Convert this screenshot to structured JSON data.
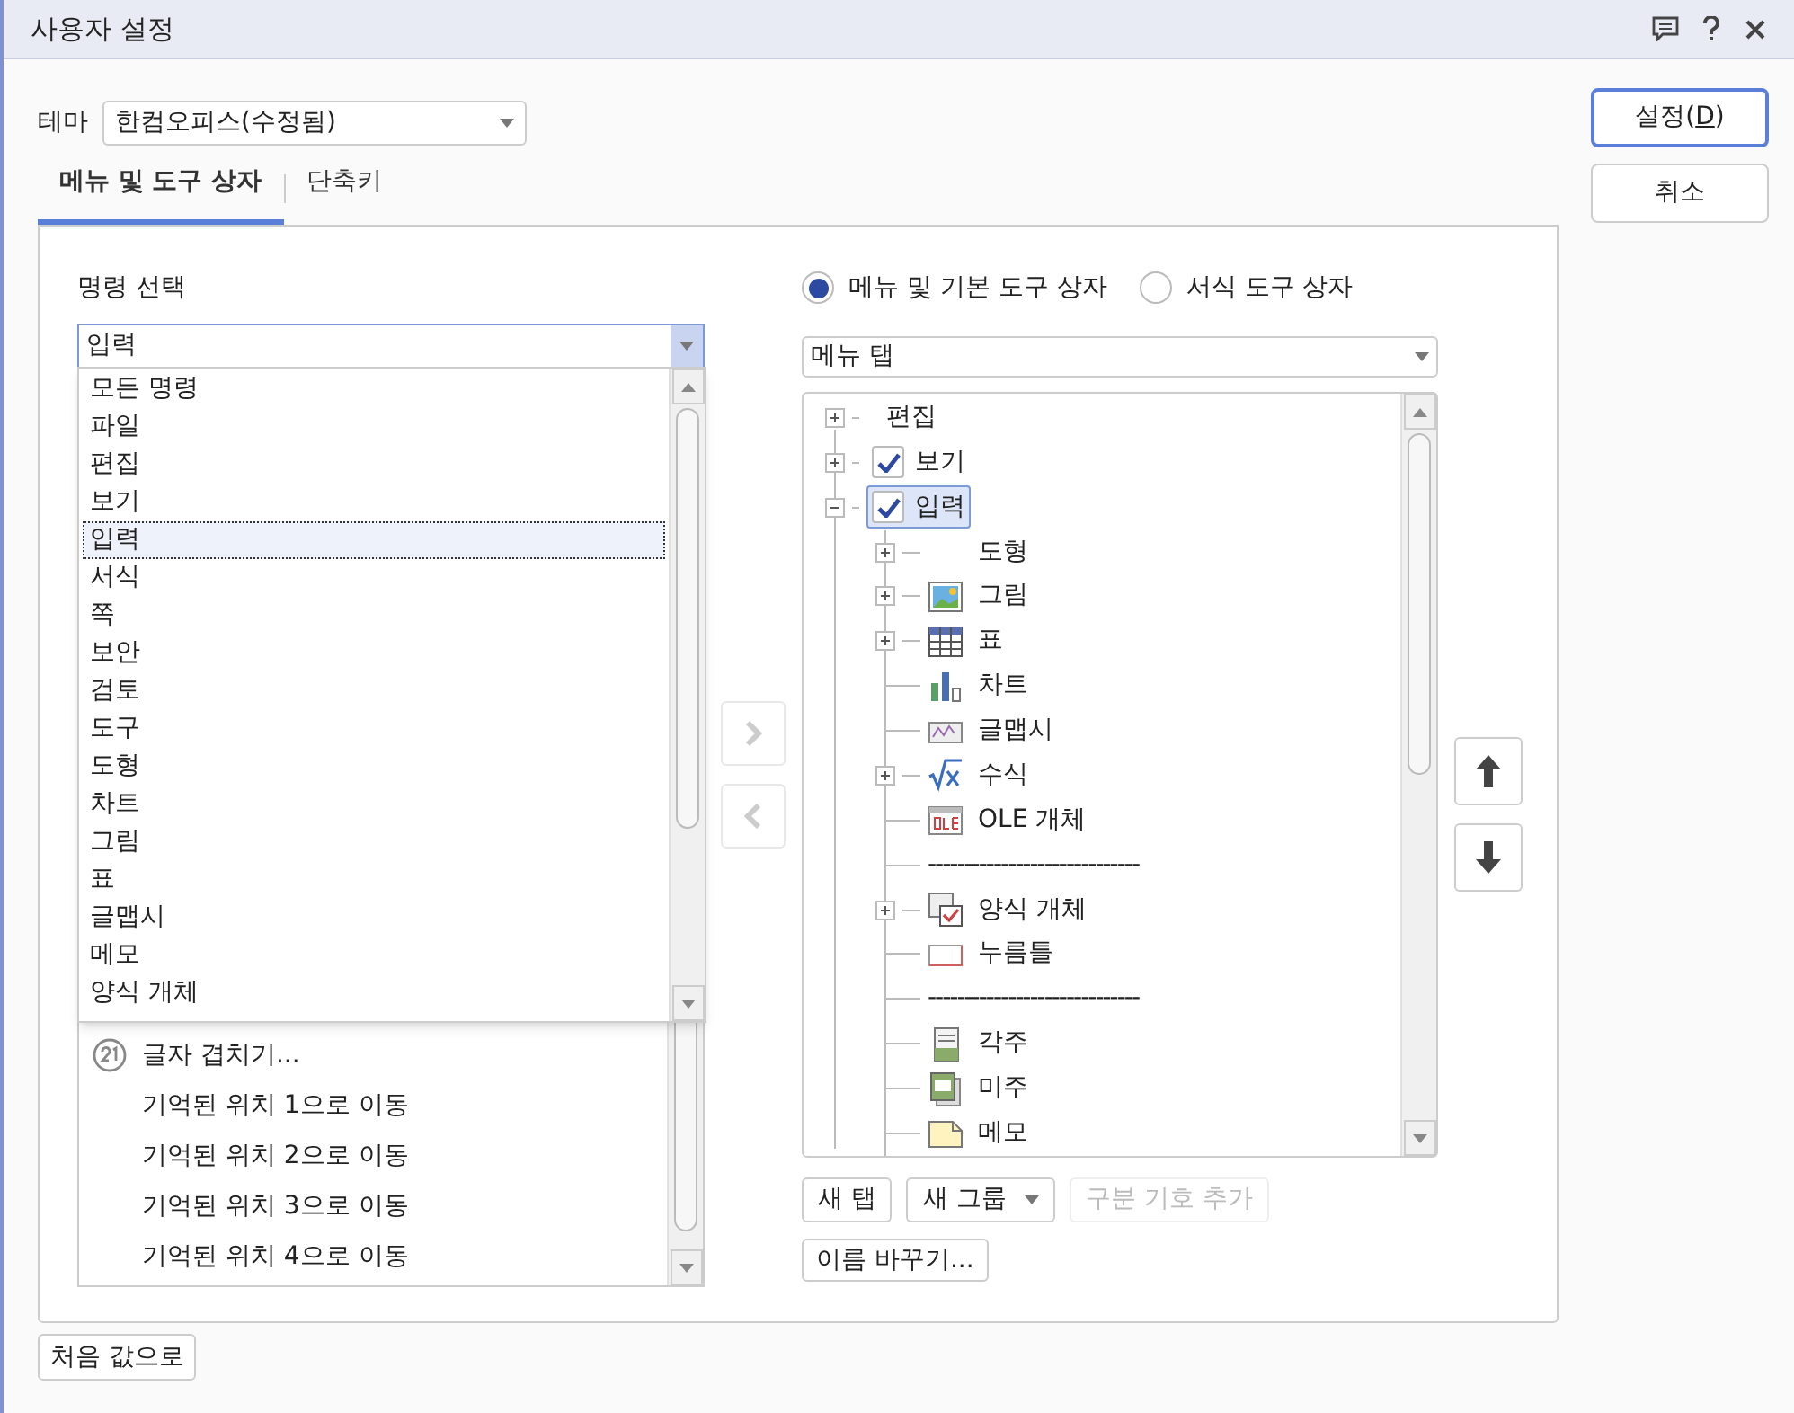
{
  "window": {
    "title": "사용자 설정"
  },
  "theme": {
    "label": "테마",
    "value": "한컴오피스(수정됨)"
  },
  "tabs": [
    {
      "label": "메뉴 및 도구 상자",
      "selected": true
    },
    {
      "label": "단축키",
      "selected": false
    }
  ],
  "command_select": {
    "label": "명령 선택",
    "value": "입력",
    "dropdown_items": [
      {
        "label": "모든 명령",
        "selected": false
      },
      {
        "label": "파일",
        "selected": false
      },
      {
        "label": "편집",
        "selected": false
      },
      {
        "label": "보기",
        "selected": false
      },
      {
        "label": "입력",
        "selected": true
      },
      {
        "label": "서식",
        "selected": false
      },
      {
        "label": "쪽",
        "selected": false
      },
      {
        "label": "보안",
        "selected": false
      },
      {
        "label": "검토",
        "selected": false
      },
      {
        "label": "도구",
        "selected": false
      },
      {
        "label": "도형",
        "selected": false
      },
      {
        "label": "차트",
        "selected": false
      },
      {
        "label": "그림",
        "selected": false
      },
      {
        "label": "표",
        "selected": false
      },
      {
        "label": "글맵시",
        "selected": false
      },
      {
        "label": "메모",
        "selected": false
      },
      {
        "label": "양식 개체",
        "selected": false
      }
    ],
    "commands": [
      {
        "label": "글자 겹치기...",
        "kind": "icon"
      },
      {
        "label": "기억된 위치 1으로 이동",
        "kind": "plain"
      },
      {
        "label": "기억된 위치 2으로 이동",
        "kind": "plain"
      },
      {
        "label": "기억된 위치 3으로 이동",
        "kind": "plain"
      },
      {
        "label": "기억된 위치 4으로 이동",
        "kind": "plain"
      }
    ]
  },
  "toolbox_type": [
    {
      "label": "메뉴 및 기본 도구 상자",
      "selected": true
    },
    {
      "label": "서식 도구 상자",
      "selected": false
    }
  ],
  "menu_select": {
    "value": "메뉴 탭"
  },
  "tree": [
    {
      "label": "편집",
      "kind": "plain",
      "expanded": false,
      "selected": false
    },
    {
      "label": "보기",
      "kind": "checkbox",
      "checked": true,
      "expanded": false,
      "selected": false
    },
    {
      "label": "입력",
      "kind": "checkbox",
      "checked": true,
      "expanded": true,
      "selected": true,
      "children": [
        {
          "label": "도형",
          "kind": "group"
        },
        {
          "label": "그림",
          "kind": "group"
        },
        {
          "label": "표",
          "kind": "group"
        },
        {
          "label": "차트",
          "kind": "command"
        },
        {
          "label": "글맵시",
          "kind": "command"
        },
        {
          "label": "수식",
          "kind": "group"
        },
        {
          "label": "OLE 개체",
          "kind": "command"
        },
        {
          "label": "-----------------------------",
          "kind": "separator"
        },
        {
          "label": "양식 개체",
          "kind": "group"
        },
        {
          "label": "누름틀",
          "kind": "command"
        },
        {
          "label": "-----------------------------",
          "kind": "separator"
        },
        {
          "label": "각주",
          "kind": "command"
        },
        {
          "label": "미주",
          "kind": "command"
        },
        {
          "label": "메모",
          "kind": "command"
        }
      ]
    }
  ],
  "tree_buttons": [
    {
      "label": "새 탭",
      "kind": "button",
      "disabled": false
    },
    {
      "label": "새 그룹",
      "kind": "dropdown",
      "disabled": false
    },
    {
      "label": "구분 기호 추가",
      "kind": "button",
      "disabled": true
    },
    {
      "label": "이름 바꾸기...",
      "kind": "button",
      "disabled": false
    }
  ],
  "reset_button": "처음 값으로",
  "dialog_buttons": [
    {
      "label_before": "설정(",
      "accesskey": "D",
      "label_after": ")",
      "default": true
    },
    {
      "label": "취소",
      "default": false
    }
  ]
}
